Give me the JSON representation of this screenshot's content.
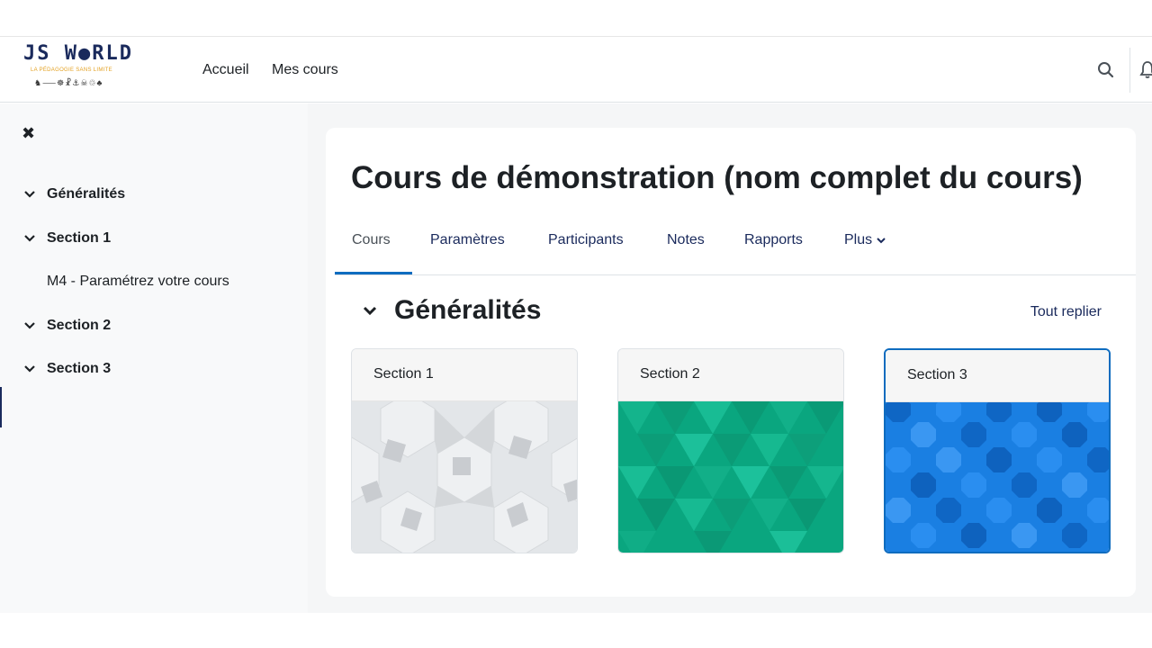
{
  "logo": {
    "title": "JS W●RLD",
    "subtitle": "LA PÉDAGOGIE SANS LIMITE",
    "figures": "♞⸺☸☧⚓☠♲♣"
  },
  "navbar": {
    "links": [
      "Accueil",
      "Mes cours"
    ],
    "search_icon": "search-icon",
    "notification_icon": "bell-icon"
  },
  "drawer": {
    "close_icon": "close-icon",
    "items": [
      {
        "label": "Généralités",
        "type": "section"
      },
      {
        "label": "Section 1",
        "type": "section"
      },
      {
        "label": "M4 - Paramétrez votre cours",
        "type": "activity"
      },
      {
        "label": "Section 2",
        "type": "section"
      },
      {
        "label": "Section 3",
        "type": "section"
      }
    ]
  },
  "course": {
    "title": "Cours de démonstration (nom complet du cours)",
    "tabs": [
      "Cours",
      "Paramètres",
      "Participants",
      "Notes",
      "Rapports",
      "Plus"
    ],
    "active_tab": "Cours",
    "section": {
      "title": "Généralités",
      "collapse_all": "Tout replier"
    },
    "cards": [
      {
        "title": "Section 1",
        "pattern": "grey-hexagon",
        "color": "#e2e6e9"
      },
      {
        "title": "Section 2",
        "pattern": "green-triangle",
        "color": "#0fae86"
      },
      {
        "title": "Section 3",
        "pattern": "blue-octagon",
        "color": "#1b7fe3",
        "selected": true
      }
    ]
  },
  "colors": {
    "brand": "#1a2a5c",
    "accent": "#0f6cbf",
    "logo_accent": "#e3a020"
  }
}
